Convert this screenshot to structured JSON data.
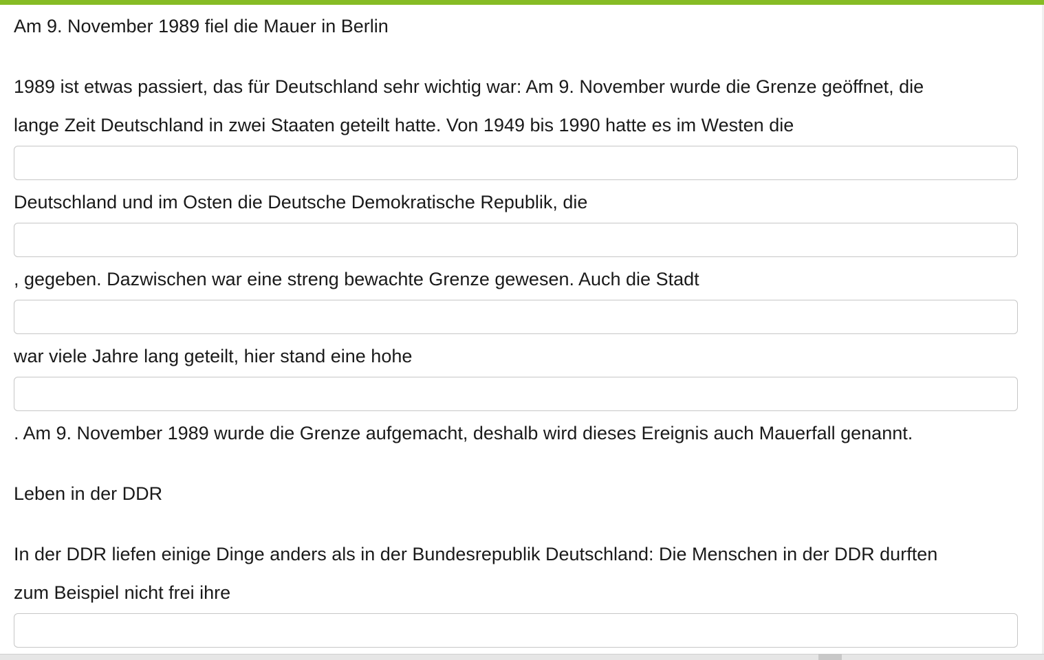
{
  "exercise": {
    "title": "Am 9. November 1989 fiel die Mauer in Berlin",
    "p1_line1": "1989 ist etwas passiert, das für Deutschland sehr wichtig war: Am 9. November wurde die Grenze geöffnet, die",
    "p1_line2": "lange Zeit Deutschland in zwei Staaten geteilt hatte. Von 1949 bis 1990 hatte es im Westen die",
    "text_after_gap1": "Deutschland und im Osten die Deutsche Demokratische Republik, die",
    "text_after_gap2": ", gegeben. Dazwischen war eine streng bewachte Grenze gewesen. Auch die Stadt",
    "text_after_gap3": "war viele Jahre lang geteilt, hier stand eine hohe",
    "text_after_gap4": ". Am 9. November 1989 wurde die Grenze aufgemacht, deshalb wird dieses Ereignis auch Mauerfall genannt.",
    "heading2": "Leben in der DDR",
    "p2_line1": "In der DDR liefen einige Dinge anders als in der Bundesrepublik Deutschland: Die Menschen in der DDR durften",
    "p2_line2": "zum Beispiel nicht frei ihre",
    "gaps": [
      "",
      "",
      "",
      "",
      ""
    ]
  },
  "colors": {
    "accent": "#86bc25",
    "text": "#1a1a1a",
    "input_border": "#c6c6c6"
  }
}
